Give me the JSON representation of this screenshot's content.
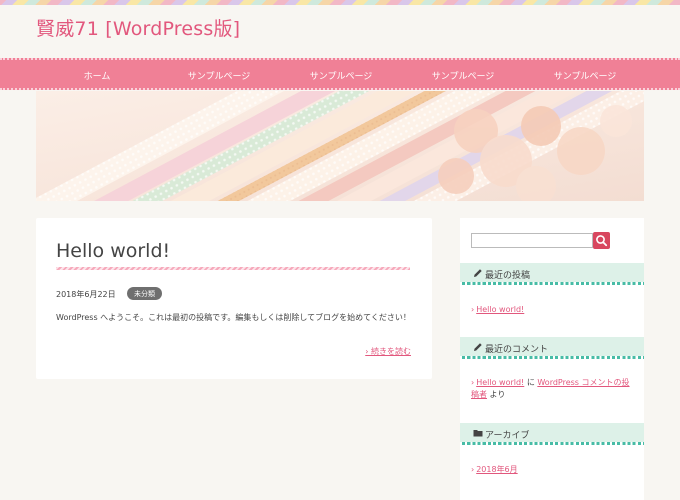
{
  "site": {
    "title": "賢威71 [WordPress版]"
  },
  "nav": {
    "items": [
      {
        "label": "ホーム"
      },
      {
        "label": "サンプルページ"
      },
      {
        "label": "サンプルページ"
      },
      {
        "label": "サンプルページ"
      },
      {
        "label": "サンプルページ"
      }
    ]
  },
  "post": {
    "title": "Hello world!",
    "date": "2018年6月22日",
    "category": "未分類",
    "excerpt": "WordPress へようこそ。これは最初の投稿です。編集もしくは削除してブログを始めてください！",
    "read_more": "続きを読む"
  },
  "sidebar": {
    "search_placeholder": "",
    "recent_posts": {
      "title": "最近の投稿",
      "items": [
        "Hello world!"
      ]
    },
    "recent_comments": {
      "title": "最近のコメント",
      "post_link": "Hello world!",
      "connector": "に",
      "author_link": "WordPress コメントの投稿者",
      "suffix": "より"
    },
    "archives": {
      "title": "アーカイブ",
      "items": [
        "2018年6月"
      ]
    }
  },
  "icons": {
    "recent_posts": "pencil-icon",
    "recent_comments": "pencil-icon",
    "archives": "folder-icon",
    "search": "search-icon"
  },
  "colors": {
    "accent": "#e2577d",
    "nav": "#f08096",
    "widget_bg": "#ddf1e8",
    "widget_border": "#48bca6"
  }
}
